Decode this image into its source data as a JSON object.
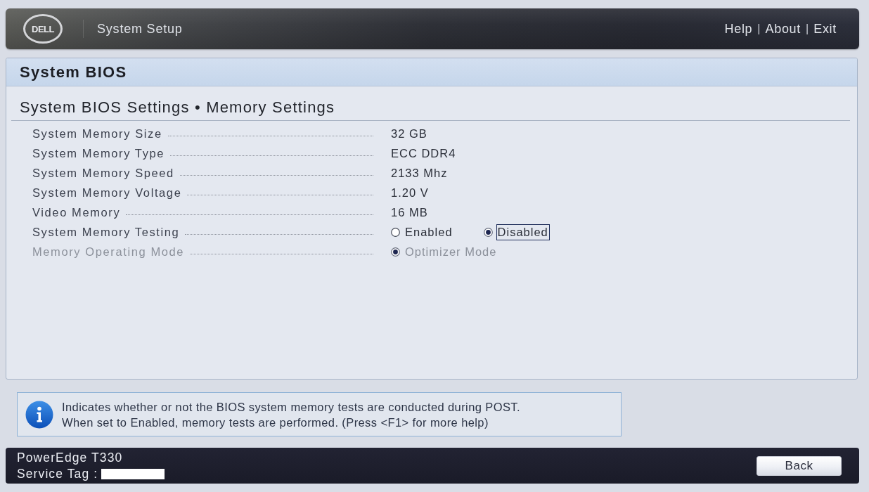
{
  "header": {
    "logo": "DELL",
    "title": "System Setup",
    "links": [
      {
        "label": "Help"
      },
      {
        "label": "About"
      },
      {
        "label": "Exit"
      }
    ],
    "separator": "|"
  },
  "panel": {
    "title": "System BIOS",
    "breadcrumb": "System BIOS Settings • Memory Settings"
  },
  "rows": [
    {
      "label": "System Memory Size",
      "kind": "value",
      "value": "32 GB",
      "disabled": false
    },
    {
      "label": "System Memory Type",
      "kind": "value",
      "value": "ECC DDR4",
      "disabled": false
    },
    {
      "label": "System Memory Speed",
      "kind": "value",
      "value": "2133 Mhz",
      "disabled": false
    },
    {
      "label": "System Memory Voltage",
      "kind": "value",
      "value": "1.20 V",
      "disabled": false
    },
    {
      "label": "Video Memory",
      "kind": "value",
      "value": "16 MB",
      "disabled": false
    },
    {
      "label": "System Memory Testing",
      "kind": "radio",
      "disabled": false,
      "options": [
        {
          "label": "Enabled",
          "selected": false,
          "focused": false
        },
        {
          "label": "Disabled",
          "selected": true,
          "focused": true
        }
      ]
    },
    {
      "label": "Memory Operating Mode",
      "kind": "radio",
      "disabled": true,
      "options": [
        {
          "label": "Optimizer Mode",
          "selected": true,
          "focused": false
        }
      ]
    }
  ],
  "help": {
    "lines": [
      "Indicates whether or not the BIOS system memory tests are conducted during POST.",
      "When set to Enabled, memory tests are performed. (Press <F1> for more help)"
    ]
  },
  "footer": {
    "model": "PowerEdge T330",
    "service_tag": {
      "label": "Service Tag :",
      "redacted": true
    },
    "buttons": [
      {
        "label": "Back"
      }
    ]
  }
}
